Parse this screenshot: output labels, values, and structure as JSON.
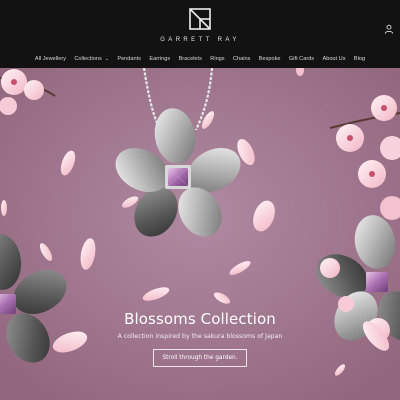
{
  "brand": {
    "name": "GARRETT RAY",
    "logo_icon": "gr-monogram-icon"
  },
  "header": {
    "account_icon": "user-account-icon"
  },
  "nav": {
    "items": [
      {
        "label": "All Jewellery"
      },
      {
        "label": "Collections",
        "has_dropdown": true
      },
      {
        "label": "Pendants"
      },
      {
        "label": "Earrings"
      },
      {
        "label": "Bracelets"
      },
      {
        "label": "Rings"
      },
      {
        "label": "Chains"
      },
      {
        "label": "Bespoke"
      },
      {
        "label": "Gift Cards"
      },
      {
        "label": "About Us"
      },
      {
        "label": "Blog"
      }
    ]
  },
  "hero": {
    "title": "Blossoms Collection",
    "subtitle": "A collection inspired by the sakura blossoms of Japan",
    "button_label": "Stroll through the garden.",
    "background_color": "#a47b95",
    "image": "sakura-blossom-pendant-image"
  },
  "colors": {
    "header_bg": "#121212",
    "nav_text": "#d8d8d8",
    "accent_text": "#ffffff"
  }
}
